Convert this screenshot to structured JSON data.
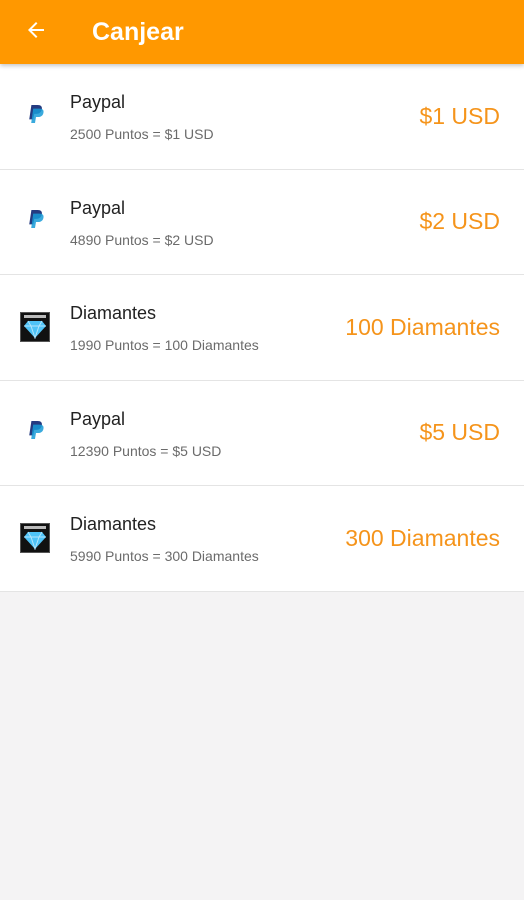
{
  "app_bar": {
    "title": "Canjear",
    "back_icon": "arrow-left-icon",
    "color": "#ff9800"
  },
  "accent_color": "#f5941b",
  "rewards": [
    {
      "icon": "paypal-icon",
      "name": "Paypal",
      "desc": "2500 Puntos = $1 USD",
      "value": "$1 USD"
    },
    {
      "icon": "diamond-icon",
      "name": "Paypal",
      "desc": "4890 Puntos = $2 USD",
      "value": "$2 USD"
    },
    {
      "icon": "diamond-icon",
      "name": "Diamantes",
      "desc": "1990 Puntos = 100 Diamantes",
      "value": "100 Diamantes"
    },
    {
      "icon": "paypal-icon",
      "name": "Paypal",
      "desc": "12390 Puntos = $5 USD",
      "value": "$5 USD"
    },
    {
      "icon": "diamond-icon",
      "name": "Diamantes",
      "desc": "5990 Puntos = 300 Diamantes",
      "value": "300 Diamantes"
    }
  ]
}
